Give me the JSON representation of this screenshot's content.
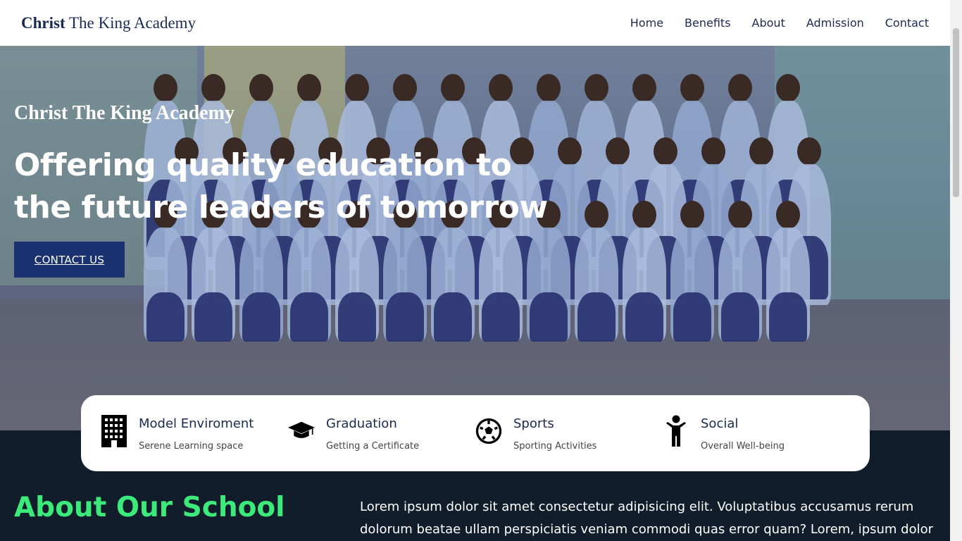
{
  "header": {
    "brand_bold": "Christ",
    "brand_rest": " The King Academy",
    "nav": [
      "Home",
      "Benefits",
      "About",
      "Admission",
      "Contact"
    ]
  },
  "hero": {
    "subtitle": "Christ The King Academy",
    "title": "Offering quality education to the future leaders of tomorrow",
    "cta_label": "CONTACT US"
  },
  "features": [
    {
      "icon": "building-icon",
      "title": "Model Enviroment",
      "desc": "Serene Learning space"
    },
    {
      "icon": "graduation-cap-icon",
      "title": "Graduation",
      "desc": "Getting a Certificate"
    },
    {
      "icon": "soccer-ball-icon",
      "title": "Sports",
      "desc": "Sporting Activities"
    },
    {
      "icon": "child-icon",
      "title": "Social",
      "desc": "Overall Well-being"
    }
  ],
  "about": {
    "title": "About Our School",
    "text": "Lorem ipsum dolor sit amet consectetur adipisicing elit. Voluptatibus accusamus rerum dolorum beatae ullam perspiciatis veniam commodi quas error quam? Lorem, ipsum dolor sit"
  },
  "colors": {
    "brand": "#1b2a52",
    "cta": "#1b3270",
    "accent_green": "#3bea7a",
    "dark_bg": "#111d2b"
  }
}
